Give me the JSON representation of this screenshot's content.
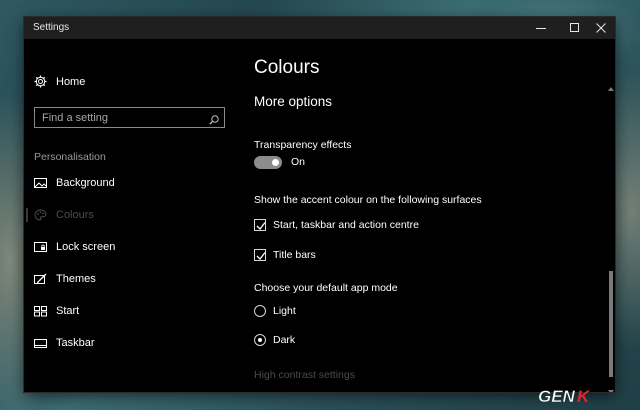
{
  "window": {
    "title": "Settings",
    "controls": {
      "minimize_icon": "minimize-icon",
      "maximize_icon": "maximize-icon",
      "close_icon": "close-icon"
    }
  },
  "sidebar": {
    "home": {
      "label": "Home",
      "icon": "gear-icon"
    },
    "search": {
      "placeholder": "Find a setting",
      "value": "",
      "icon": "search-icon"
    },
    "section_label": "Personalisation",
    "items": [
      {
        "label": "Background",
        "icon": "picture-icon",
        "active": false
      },
      {
        "label": "Colours",
        "icon": "palette-icon",
        "active": true
      },
      {
        "label": "Lock screen",
        "icon": "lock-screen-icon",
        "active": false
      },
      {
        "label": "Themes",
        "icon": "paintbrush-icon",
        "active": false
      },
      {
        "label": "Start",
        "icon": "start-icon",
        "active": false
      },
      {
        "label": "Taskbar",
        "icon": "taskbar-icon",
        "active": false
      }
    ]
  },
  "main": {
    "page_title": "Colours",
    "sub_title": "More options",
    "transparency": {
      "label": "Transparency effects",
      "state": "On",
      "enabled": true
    },
    "accent": {
      "label": "Show the accent colour on the following surfaces",
      "options": [
        {
          "label": "Start, taskbar and action centre",
          "checked": true
        },
        {
          "label": "Title bars",
          "checked": true
        }
      ]
    },
    "app_mode": {
      "label": "Choose your default app mode",
      "options": [
        {
          "label": "Light",
          "selected": false
        },
        {
          "label": "Dark",
          "selected": true
        }
      ]
    },
    "high_contrast_link": "High contrast settings"
  },
  "colors": {
    "window_background": "#000000",
    "titlebar_background": "#1f1f1f",
    "text_primary": "#ffffff",
    "text_secondary": "#9a9a9a",
    "text_disabled": "#4a4a4a",
    "toggle_track": "#8c8c8c"
  },
  "watermark": {
    "text": "GENK"
  }
}
